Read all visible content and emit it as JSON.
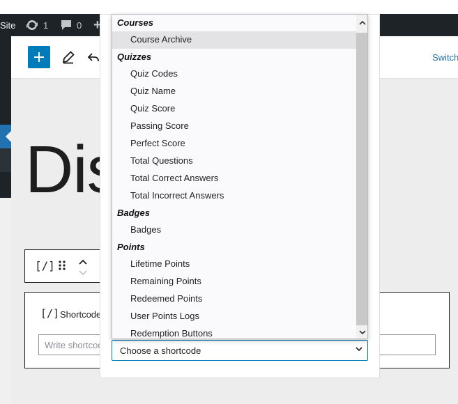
{
  "admin_bar": {
    "site_label": "Site",
    "updates_count": "1",
    "comments_count": "0",
    "new_label": "+"
  },
  "editor_header": {
    "switch_label": "Switch"
  },
  "post": {
    "title_visible": "Dis"
  },
  "shortcode_block": {
    "label": "Shortcode",
    "input_placeholder": "Write shortcode here…"
  },
  "select": {
    "selected": "Choose a shortcode"
  },
  "dropdown": {
    "groups": [
      {
        "label": "Courses",
        "options": [
          "Course Archive"
        ]
      },
      {
        "label": "Quizzes",
        "options": [
          "Quiz Codes",
          "Quiz Name",
          "Quiz Score",
          "Passing Score",
          "Perfect Score",
          "Total Questions",
          "Total Correct Answers",
          "Total Incorrect Answers"
        ]
      },
      {
        "label": "Badges",
        "options": [
          "Badges"
        ]
      },
      {
        "label": "Points",
        "options": [
          "Lifetime Points",
          "Remaining Points",
          "Redeemed Points",
          "User Points Logs",
          "Redemption Buttons"
        ]
      }
    ],
    "highlighted": "Course Archive"
  },
  "colors": {
    "admin_bar": "#1d2327",
    "accent": "#007cba",
    "highlight": "#e3e3e6"
  }
}
